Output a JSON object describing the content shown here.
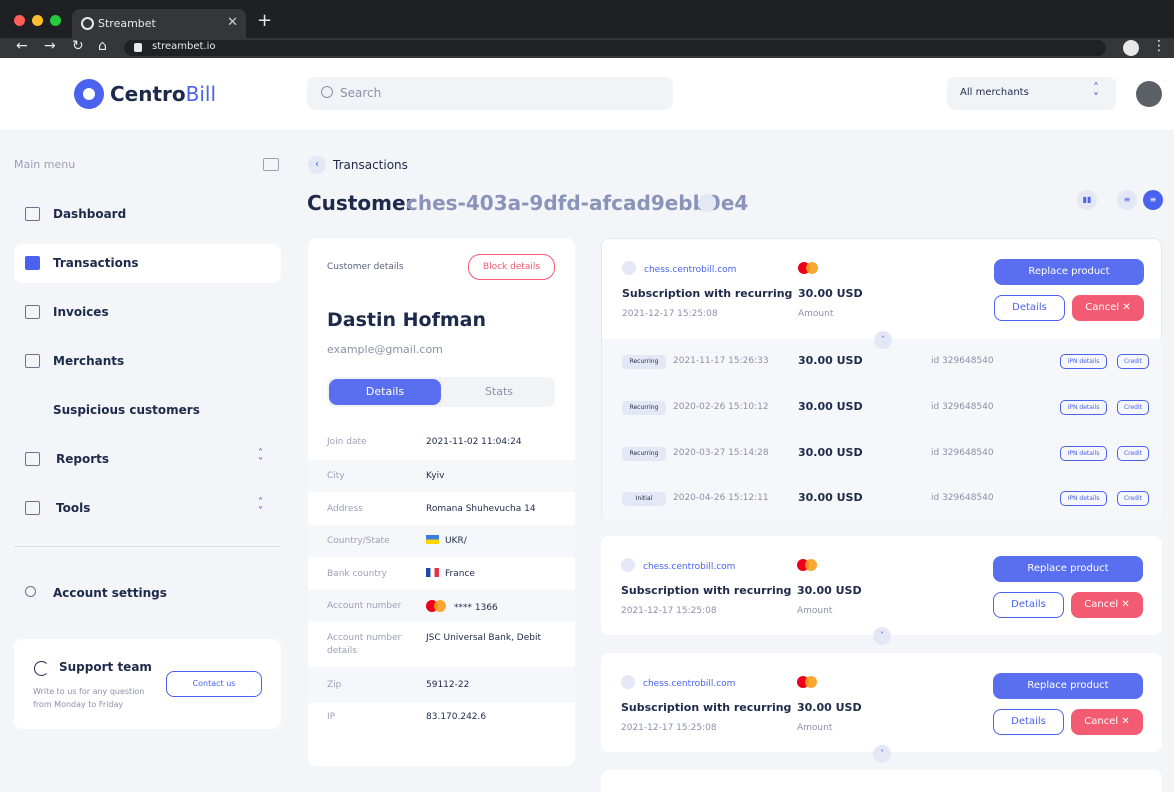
{
  "browser": {
    "tab_title": "Streambet",
    "tab_close": "✕",
    "new_tab": "+",
    "url": "streambet.io"
  },
  "header": {
    "logo_a": "Centro",
    "logo_b": "Bill",
    "search_placeholder": "Search",
    "merchant_select": "All merchants"
  },
  "sidebar": {
    "menu_title": "Main menu",
    "items": [
      {
        "label": "Dashboard"
      },
      {
        "label": "Transactions"
      },
      {
        "label": "Invoices"
      },
      {
        "label": "Merchants"
      },
      {
        "label": "Suspicious customers"
      },
      {
        "label": "Reports"
      },
      {
        "label": "Tools"
      },
      {
        "label": "Account settings"
      }
    ],
    "support": {
      "title": "Support team",
      "desc": "Write to us for any question from Monday to Friday",
      "button": "Contact us"
    }
  },
  "page": {
    "breadcrumb": "Transactions",
    "title_prefix": "Customer",
    "title_id": "ches-403a-9dfd-afcad9ebb9e4"
  },
  "customer": {
    "section_label": "Customer details",
    "block_button": "Block details",
    "name": "Dastin Hofman",
    "email": "example@gmail.com",
    "tab_details": "Details",
    "tab_stats": "Stats",
    "rows": [
      {
        "key": "Join date",
        "value": "2021-11-02 11:04:24"
      },
      {
        "key": "City",
        "value": "Kyiv"
      },
      {
        "key": "Address",
        "value": "Romana Shuhevucha 14"
      },
      {
        "key": "Country/State",
        "value": "UKR/"
      },
      {
        "key": "Bank country",
        "value": "France"
      },
      {
        "key": "Account number",
        "value": "**** 1366"
      },
      {
        "key": "Account number details",
        "value": "JSC Universal Bank, Debit"
      },
      {
        "key": "Zip",
        "value": "59112-22"
      },
      {
        "key": "IP",
        "value": "83.170.242.6"
      }
    ]
  },
  "transactions": [
    {
      "site": "chess.centrobill.com",
      "name": "Subscription with recurring",
      "date": "2021-12-17 15:25:08",
      "amount": "30.00 USD",
      "amount_label": "Amount",
      "replace": "Replace product",
      "details": "Details",
      "cancel": "Cancel ✕",
      "sub_rows": [
        {
          "type": "Recurring",
          "date": "2021-11-17 15:26:33",
          "amount": "30.00 USD",
          "id": "id 329648540",
          "ipn": "IPN details",
          "credit": "Credit"
        },
        {
          "type": "Recurring",
          "date": "2020-02-26 15:10:12",
          "amount": "30.00 USD",
          "id": "id 329648540",
          "ipn": "IPN details",
          "credit": "Credit"
        },
        {
          "type": "Recurring",
          "date": "2020-03-27 15:14:28",
          "amount": "30.00 USD",
          "id": "id 329648540",
          "ipn": "IPN details",
          "credit": "Credit"
        },
        {
          "type": "Initial",
          "date": "2020-04-26 15:12:11",
          "amount": "30.00 USD",
          "id": "id 329648540",
          "ipn": "IPN details",
          "credit": "Credit"
        }
      ]
    },
    {
      "site": "chess.centrobill.com",
      "name": "Subscription with recurring",
      "date": "2021-12-17 15:25:08",
      "amount": "30.00 USD",
      "amount_label": "Amount",
      "replace": "Replace product",
      "details": "Details",
      "cancel": "Cancel ✕"
    },
    {
      "site": "chess.centrobill.com",
      "name": "Subscription with recurring",
      "date": "2021-12-17 15:25:08",
      "amount": "30.00 USD",
      "amount_label": "Amount",
      "replace": "Replace product",
      "details": "Details",
      "cancel": "Cancel ✕"
    }
  ],
  "colors": {
    "accent": "#4a62ee",
    "danger": "#f25b72",
    "text": "#1e2a4a"
  }
}
